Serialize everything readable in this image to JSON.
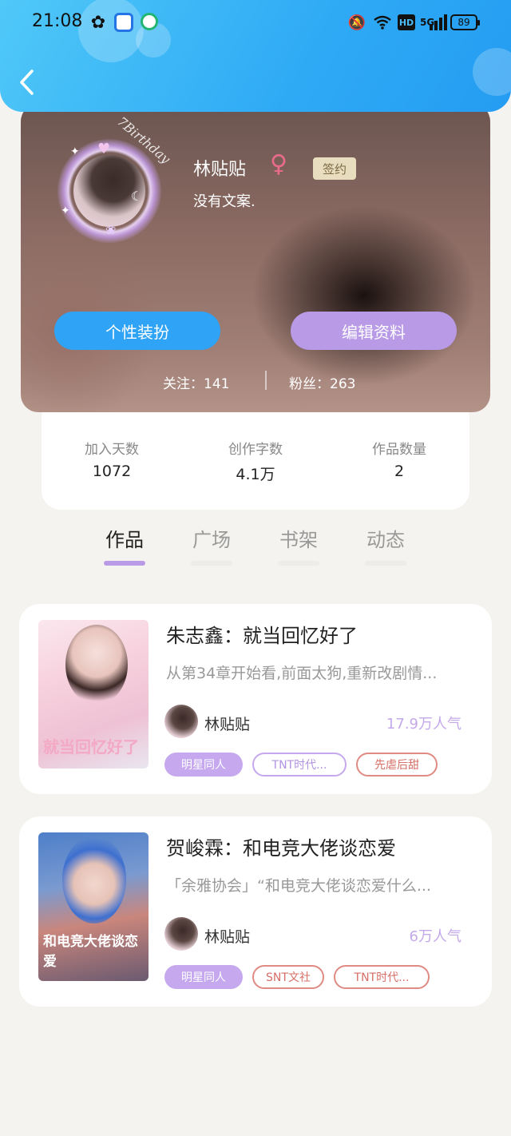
{
  "status_bar": {
    "time": "21:08",
    "network": "5G",
    "hd": "HD",
    "battery": "89"
  },
  "header": {
    "back_icon": "chevron-left-icon",
    "color": "#2eaaf5"
  },
  "profile": {
    "username": "林贴贴",
    "gender_symbol": "♀",
    "sign_badge": "签约",
    "bio": "没有文案.",
    "avatar_frame_text": "7Birthday",
    "decorate_button": "个性装扮",
    "edit_button": "编辑资料",
    "follow_label": "关注：141",
    "fans_label": "粉丝：263"
  },
  "stats": [
    {
      "label": "加入天数",
      "value": "1072"
    },
    {
      "label": "创作字数",
      "value": "4.1万"
    },
    {
      "label": "作品数量",
      "value": "2"
    }
  ],
  "tabs": [
    {
      "label": "作品",
      "active": true
    },
    {
      "label": "广场",
      "active": false
    },
    {
      "label": "书架",
      "active": false
    },
    {
      "label": "动态",
      "active": false
    }
  ],
  "works": [
    {
      "title": "朱志鑫：就当回忆好了",
      "desc": "从第34章开始看,前面太狗,重新改剧情...",
      "author": "林贴贴",
      "popularity": "17.9万人气",
      "cover_text": "就当回忆好了",
      "tags": [
        "明星同人",
        "TNT时代...",
        "先虐后甜"
      ]
    },
    {
      "title": "贺峻霖：和电竞大佬谈恋爱",
      "desc": "「余雅协会」“和电竞大佬谈恋爱什么...",
      "author": "林贴贴",
      "popularity": "6万人气",
      "cover_text": "和电竞大佬谈恋爱",
      "tags": [
        "明星同人",
        "SNT文社",
        "TNT时代..."
      ]
    }
  ],
  "colors": {
    "accent_blue": "#2fa3f5",
    "accent_purple": "#b89ae6",
    "tag_red": "#e08a84",
    "gender_pink": "#e96b8c"
  }
}
